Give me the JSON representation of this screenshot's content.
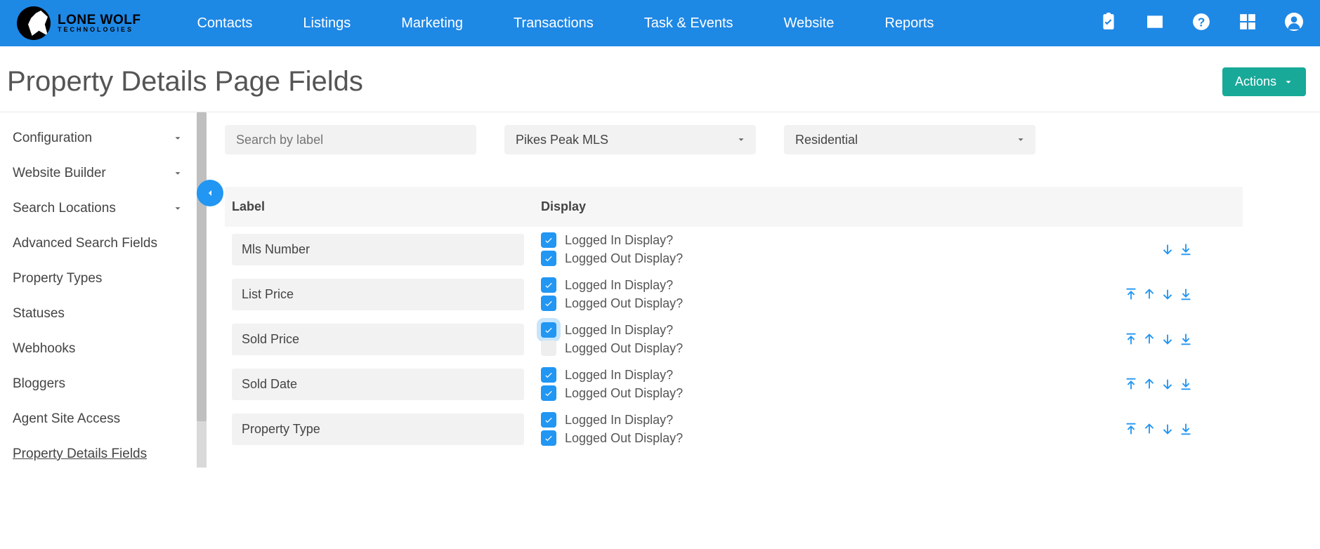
{
  "brand": {
    "name": "LONE WOLF",
    "sub": "TECHNOLOGIES"
  },
  "nav": [
    "Contacts",
    "Listings",
    "Marketing",
    "Transactions",
    "Task & Events",
    "Website",
    "Reports"
  ],
  "page_title": "Property Details Page Fields",
  "actions_label": "Actions",
  "sidebar": [
    {
      "label": "Configuration",
      "chevron": true
    },
    {
      "label": "Website Builder",
      "chevron": true
    },
    {
      "label": "Search Locations",
      "chevron": true
    },
    {
      "label": "Advanced Search Fields",
      "chevron": false
    },
    {
      "label": "Property Types",
      "chevron": false
    },
    {
      "label": "Statuses",
      "chevron": false
    },
    {
      "label": "Webhooks",
      "chevron": false
    },
    {
      "label": "Bloggers",
      "chevron": false
    },
    {
      "label": "Agent Site Access",
      "chevron": false
    },
    {
      "label": "Property Details Fields",
      "chevron": false,
      "active": true
    }
  ],
  "filters": {
    "search_placeholder": "Search by label",
    "mls": "Pikes Peak MLS",
    "prop_type": "Residential"
  },
  "columns": {
    "label": "Label",
    "display": "Display"
  },
  "check_labels": {
    "in": "Logged In Display?",
    "out": "Logged Out Display?"
  },
  "rows": [
    {
      "label": "Mls Number",
      "in": true,
      "out": true,
      "actions": [
        "down",
        "bottom"
      ],
      "highlight_in": false
    },
    {
      "label": "List Price",
      "in": true,
      "out": true,
      "actions": [
        "top",
        "up",
        "down",
        "bottom"
      ],
      "highlight_in": false
    },
    {
      "label": "Sold Price",
      "in": true,
      "out": false,
      "actions": [
        "top",
        "up",
        "down",
        "bottom"
      ],
      "highlight_in": true
    },
    {
      "label": "Sold Date",
      "in": true,
      "out": true,
      "actions": [
        "top",
        "up",
        "down",
        "bottom"
      ],
      "highlight_in": false
    },
    {
      "label": "Property Type",
      "in": true,
      "out": true,
      "actions": [
        "top",
        "up",
        "down",
        "bottom"
      ],
      "highlight_in": false
    }
  ]
}
